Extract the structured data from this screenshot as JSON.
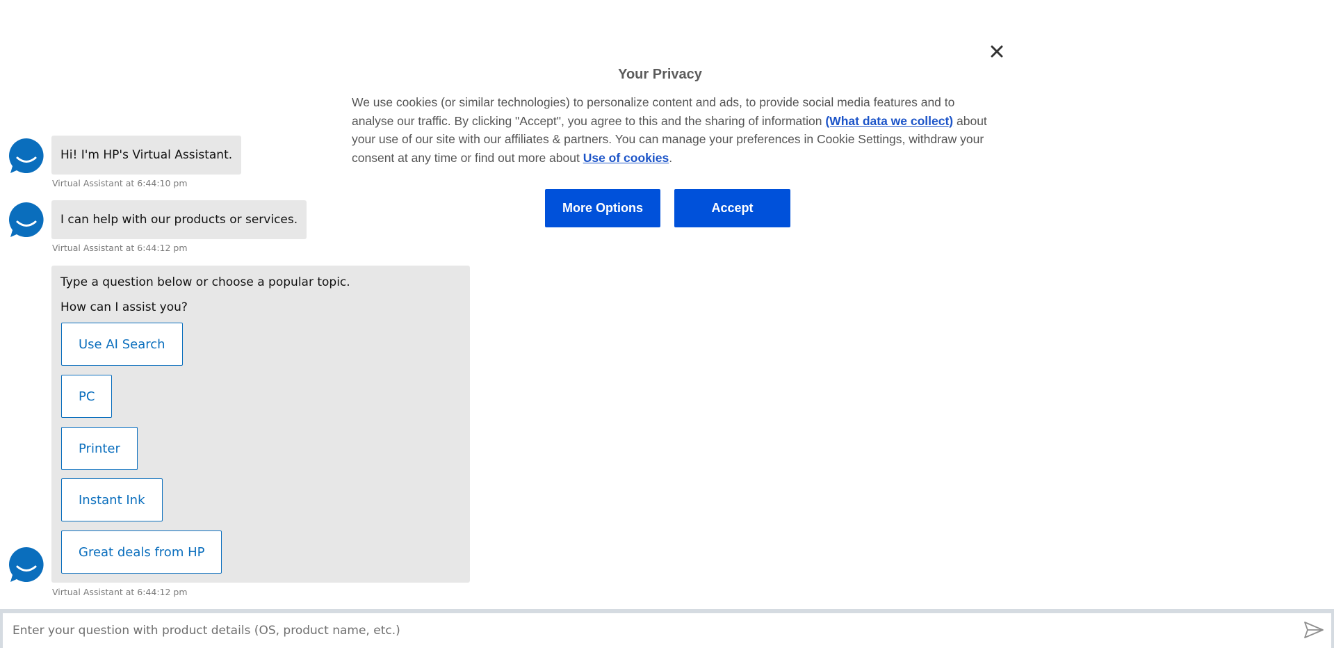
{
  "privacy": {
    "title": "Your Privacy",
    "body_part1": "We use cookies (or similar technologies) to personalize content and ads, to provide social media features and to analyse our traffic. By clicking \"Accept\", you agree to this and the sharing of information ",
    "data_link": "(What data we collect)",
    "body_part2": " about your use of our site with our affiliates & partners. You can manage your preferences in Cookie Settings, withdraw your consent at any time or find out more about  ",
    "cookies_link": "Use of cookies",
    "body_end": ".",
    "more_options_label": "More Options",
    "accept_label": "Accept",
    "close_icon": "close-icon"
  },
  "chat": {
    "messages": [
      {
        "text": "Hi! I'm HP's Virtual Assistant.",
        "timestamp": "Virtual Assistant at 6:44:10 pm"
      },
      {
        "text": "I can help with our products or services.",
        "timestamp": "Virtual Assistant at 6:44:12 pm"
      }
    ],
    "card": {
      "line1": "Type a question below or choose a popular topic.",
      "line2": "How can I assist you?",
      "topics": [
        "Use AI Search",
        "PC",
        "Printer",
        "Instant Ink",
        "Great deals from HP"
      ],
      "timestamp": "Virtual Assistant at 6:44:12 pm"
    },
    "avatar_icon": "assistant-smile-icon",
    "accent_color": "#0a6ebd"
  },
  "composer": {
    "placeholder": "Enter your question with product details (OS, product name, etc.)",
    "value": "",
    "send_icon": "send-icon"
  }
}
